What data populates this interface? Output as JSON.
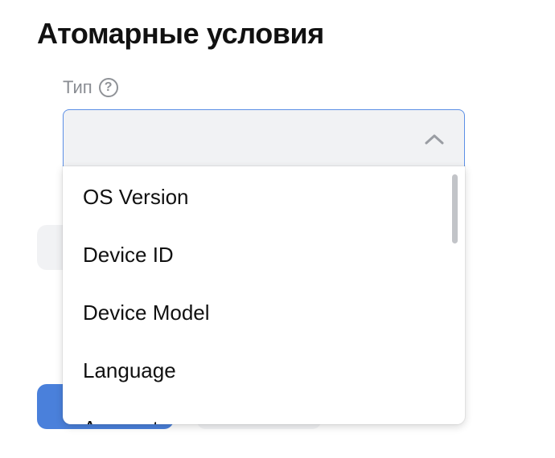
{
  "page": {
    "title": "Атомарные условия"
  },
  "type_field": {
    "label": "Тип",
    "help_icon_glyph": "?",
    "value": "",
    "expanded": true
  },
  "dropdown": {
    "options": [
      "OS Version",
      "Device ID",
      "Device Model",
      "Language",
      "Account"
    ]
  },
  "colors": {
    "accent": "#4a80db",
    "focus_border": "#5b8fe6",
    "field_background": "#f1f2f4",
    "label_gray": "#8a8d93"
  },
  "icons": {
    "help": "question-circle-icon",
    "toggle": "chevron-up-icon"
  }
}
